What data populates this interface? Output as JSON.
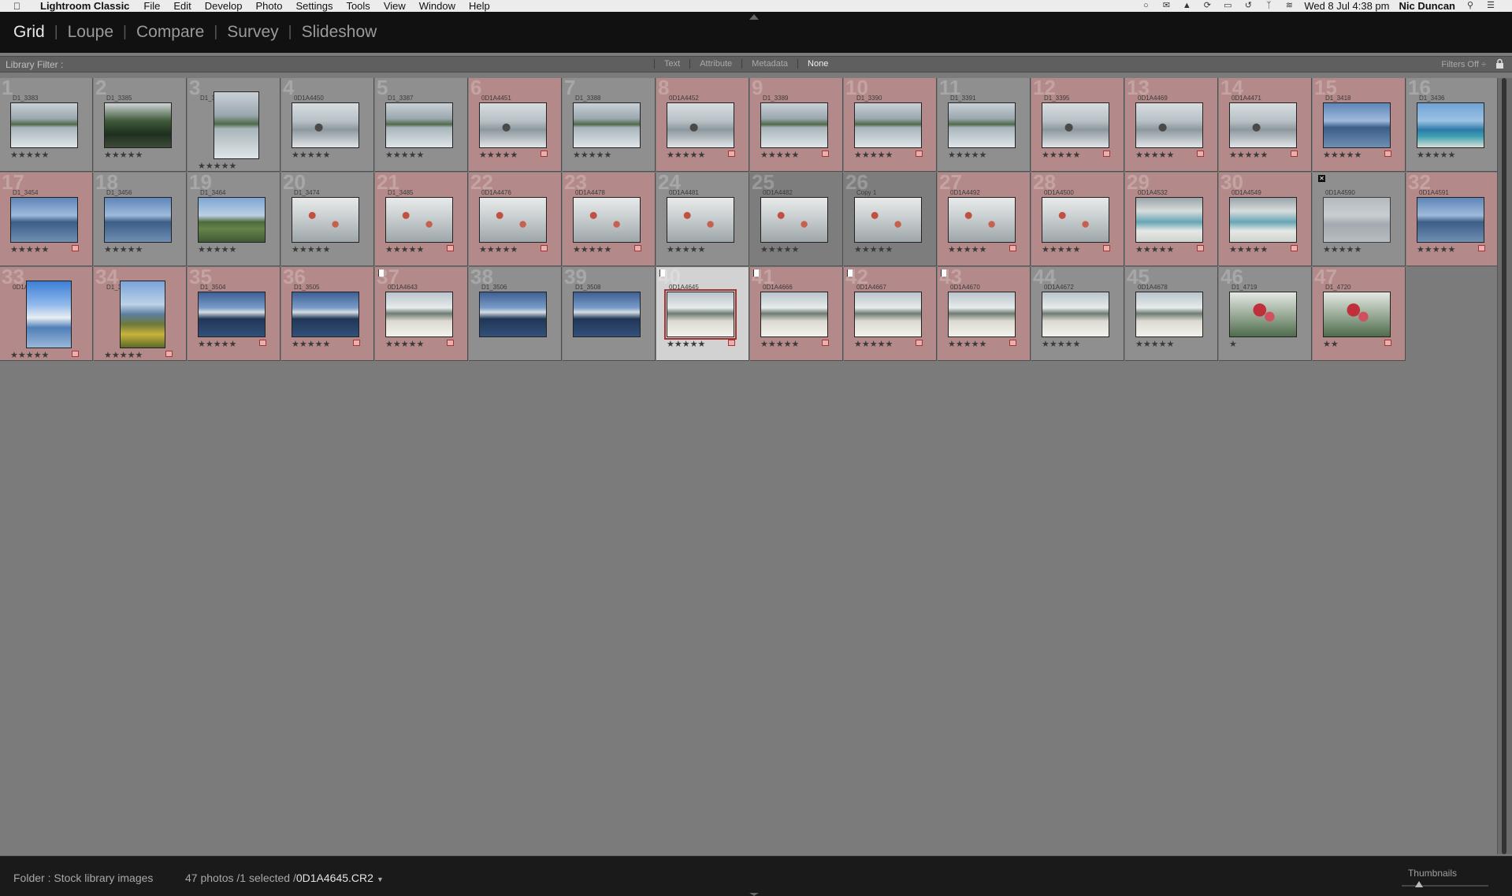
{
  "menubar": {
    "app_name": "Lightroom Classic",
    "items": [
      "File",
      "Edit",
      "Develop",
      "Photo",
      "Settings",
      "Tools",
      "View",
      "Window",
      "Help"
    ],
    "clock": "Wed 8 Jul  4:38 pm",
    "user": "Nic Duncan",
    "status_icons": [
      "creative-cloud-icon",
      "mail-icon",
      "warning-icon",
      "sync-icon",
      "airplay-icon",
      "time-machine-icon",
      "bluetooth-icon",
      "wifi-icon",
      "search-icon",
      "list-icon"
    ]
  },
  "modules": {
    "tabs": [
      "Grid",
      "Loupe",
      "Compare",
      "Survey",
      "Slideshow"
    ],
    "active": "Grid"
  },
  "filterbar": {
    "label": "Library Filter :",
    "options": [
      "Text",
      "Attribute",
      "Metadata",
      "None"
    ],
    "active": "None",
    "filters_off": "Filters Off ÷"
  },
  "grid": {
    "cells": [
      {
        "n": "1",
        "name": "D1_3383",
        "tone": "gray",
        "img": "lake",
        "orient": "land",
        "stars": "★★★★★"
      },
      {
        "n": "2",
        "name": "D1_3385",
        "tone": "gray",
        "img": "dark",
        "orient": "land",
        "stars": "★★★★★"
      },
      {
        "n": "3",
        "name": "D1_3386",
        "tone": "gray",
        "img": "lake",
        "orient": "port",
        "stars": "★★★★★"
      },
      {
        "n": "4",
        "name": "0D1A4450",
        "tone": "gray",
        "img": "trees",
        "orient": "land",
        "stars": "★★★★★"
      },
      {
        "n": "5",
        "name": "D1_3387",
        "tone": "gray",
        "img": "lake",
        "orient": "land",
        "stars": "★★★★★"
      },
      {
        "n": "6",
        "name": "0D1A4451",
        "tone": "red",
        "img": "trees",
        "orient": "land",
        "stars": "★★★★★",
        "badge": true
      },
      {
        "n": "7",
        "name": "D1_3388",
        "tone": "gray",
        "img": "lake",
        "orient": "land",
        "stars": "★★★★★"
      },
      {
        "n": "8",
        "name": "0D1A4452",
        "tone": "red",
        "img": "trees",
        "orient": "land",
        "stars": "★★★★★",
        "badge": true
      },
      {
        "n": "9",
        "name": "D1_3389",
        "tone": "red",
        "img": "lake",
        "orient": "land",
        "stars": "★★★★★",
        "badge": true
      },
      {
        "n": "10",
        "name": "D1_3390",
        "tone": "red",
        "img": "lake",
        "orient": "land",
        "stars": "★★★★★",
        "badge": true
      },
      {
        "n": "11",
        "name": "D1_3391",
        "tone": "gray",
        "img": "lake",
        "orient": "land",
        "stars": "★★★★★"
      },
      {
        "n": "12",
        "name": "D1_3395",
        "tone": "red",
        "img": "trees",
        "orient": "land",
        "stars": "★★★★★",
        "badge": true
      },
      {
        "n": "13",
        "name": "0D1A4469",
        "tone": "red",
        "img": "trees",
        "orient": "land",
        "stars": "★★★★★",
        "badge": true
      },
      {
        "n": "14",
        "name": "0D1A4471",
        "tone": "red",
        "img": "trees",
        "orient": "land",
        "stars": "★★★★★",
        "badge": true
      },
      {
        "n": "15",
        "name": "D1_3418",
        "tone": "red",
        "img": "blue",
        "orient": "land",
        "stars": "★★★★★",
        "badge": true
      },
      {
        "n": "16",
        "name": "D1_3436",
        "tone": "gray",
        "img": "coast",
        "orient": "land",
        "stars": "★★★★★"
      },
      {
        "n": "17",
        "name": "D1_3454",
        "tone": "red",
        "img": "blue",
        "orient": "land",
        "stars": "★★★★★",
        "badge": true
      },
      {
        "n": "18",
        "name": "D1_3456",
        "tone": "gray",
        "img": "blue",
        "orient": "land",
        "stars": "★★★★★"
      },
      {
        "n": "19",
        "name": "D1_3464",
        "tone": "gray",
        "img": "hills",
        "orient": "land",
        "stars": "★★★★★"
      },
      {
        "n": "20",
        "name": "D1_3474",
        "tone": "gray",
        "img": "blossom",
        "orient": "land",
        "stars": "★★★★★"
      },
      {
        "n": "21",
        "name": "D1_3485",
        "tone": "red",
        "img": "blossom",
        "orient": "land",
        "stars": "★★★★★",
        "badge": true
      },
      {
        "n": "22",
        "name": "0D1A4476",
        "tone": "red",
        "img": "blossom",
        "orient": "land",
        "stars": "★★★★★",
        "badge": true
      },
      {
        "n": "23",
        "name": "0D1A4478",
        "tone": "red",
        "img": "blossom",
        "orient": "land",
        "stars": "★★★★★",
        "badge": true
      },
      {
        "n": "24",
        "name": "0D1A4481",
        "tone": "gray",
        "img": "blossom",
        "orient": "land",
        "stars": "★★★★★"
      },
      {
        "n": "25",
        "name": "0D1A4482",
        "tone": "dim",
        "img": "blossom",
        "orient": "land",
        "stars": "★★★★★"
      },
      {
        "n": "26",
        "name": "Copy 1",
        "tone": "dim",
        "img": "blossom",
        "orient": "land",
        "stars": "★★★★★"
      },
      {
        "n": "27",
        "name": "0D1A4492",
        "tone": "red",
        "img": "blossom",
        "orient": "land",
        "stars": "★★★★★",
        "badge": true
      },
      {
        "n": "28",
        "name": "0D1A4500",
        "tone": "red",
        "img": "blossom",
        "orient": "land",
        "stars": "★★★★★",
        "badge": true
      },
      {
        "n": "29",
        "name": "0D1A4532",
        "tone": "red",
        "img": "beach",
        "orient": "land",
        "stars": "★★★★★",
        "badge": true
      },
      {
        "n": "30",
        "name": "0D1A4549",
        "tone": "red",
        "img": "beach",
        "orient": "land",
        "stars": "★★★★★",
        "badge": true
      },
      {
        "n": "",
        "name": "0D1A4590",
        "tone": "gray",
        "img": "pale",
        "orient": "land",
        "stars": "★★★★★",
        "reject": true
      },
      {
        "n": "32",
        "name": "0D1A4591",
        "tone": "red",
        "img": "blue",
        "orient": "land",
        "stars": "★★★★★",
        "badge": true
      },
      {
        "n": "33",
        "name": "0D1A4600",
        "tone": "red",
        "img": "harbor",
        "orient": "port",
        "stars": "★★★★★",
        "badge": true
      },
      {
        "n": "34",
        "name": "D1_3502",
        "tone": "red",
        "img": "yellow",
        "orient": "port",
        "stars": "★★★★★",
        "badge": true
      },
      {
        "n": "35",
        "name": "D1_3504",
        "tone": "red",
        "img": "sunset",
        "orient": "land",
        "stars": "★★★★★",
        "badge": true
      },
      {
        "n": "36",
        "name": "D1_3505",
        "tone": "red",
        "img": "sunset",
        "orient": "land",
        "stars": "★★★★★",
        "badge": true
      },
      {
        "n": "37",
        "name": "0D1A4643",
        "tone": "red",
        "img": "sand",
        "orient": "land",
        "stars": "★★★★★",
        "badge": true,
        "flag": true
      },
      {
        "n": "38",
        "name": "D1_3506",
        "tone": "gray",
        "img": "sunset",
        "orient": "land",
        "stars": ""
      },
      {
        "n": "39",
        "name": "D1_3508",
        "tone": "gray",
        "img": "sunset",
        "orient": "land",
        "stars": ""
      },
      {
        "n": "40",
        "name": "0D1A4645",
        "tone": "selected",
        "img": "sand",
        "orient": "land",
        "stars": "★★★★★",
        "badge": true,
        "flag": true
      },
      {
        "n": "41",
        "name": "0D1A4666",
        "tone": "red",
        "img": "sand",
        "orient": "land",
        "stars": "★★★★★",
        "badge": true,
        "flag": true
      },
      {
        "n": "42",
        "name": "0D1A4667",
        "tone": "red",
        "img": "sand",
        "orient": "land",
        "stars": "★★★★★",
        "badge": true,
        "flag": true
      },
      {
        "n": "43",
        "name": "0D1A4670",
        "tone": "red",
        "img": "sand",
        "orient": "land",
        "stars": "★★★★★",
        "badge": true,
        "flag": true
      },
      {
        "n": "44",
        "name": "0D1A4672",
        "tone": "gray",
        "img": "sand",
        "orient": "land",
        "stars": "★★★★★"
      },
      {
        "n": "45",
        "name": "0D1A4678",
        "tone": "gray",
        "img": "sand",
        "orient": "land",
        "stars": "★★★★★"
      },
      {
        "n": "46",
        "name": "D1_4719",
        "tone": "gray",
        "img": "flower",
        "orient": "land",
        "stars": "★"
      },
      {
        "n": "47",
        "name": "D1_4720",
        "tone": "red",
        "img": "flower",
        "orient": "land",
        "stars": "★★",
        "badge": true
      }
    ]
  },
  "statusbar": {
    "folder": "Folder : Stock library images",
    "count": "47 photos /1 selected /",
    "file": "0D1A4645.CR2",
    "thumbnails_label": "Thumbnails",
    "thumbnail_size": 0.2
  }
}
